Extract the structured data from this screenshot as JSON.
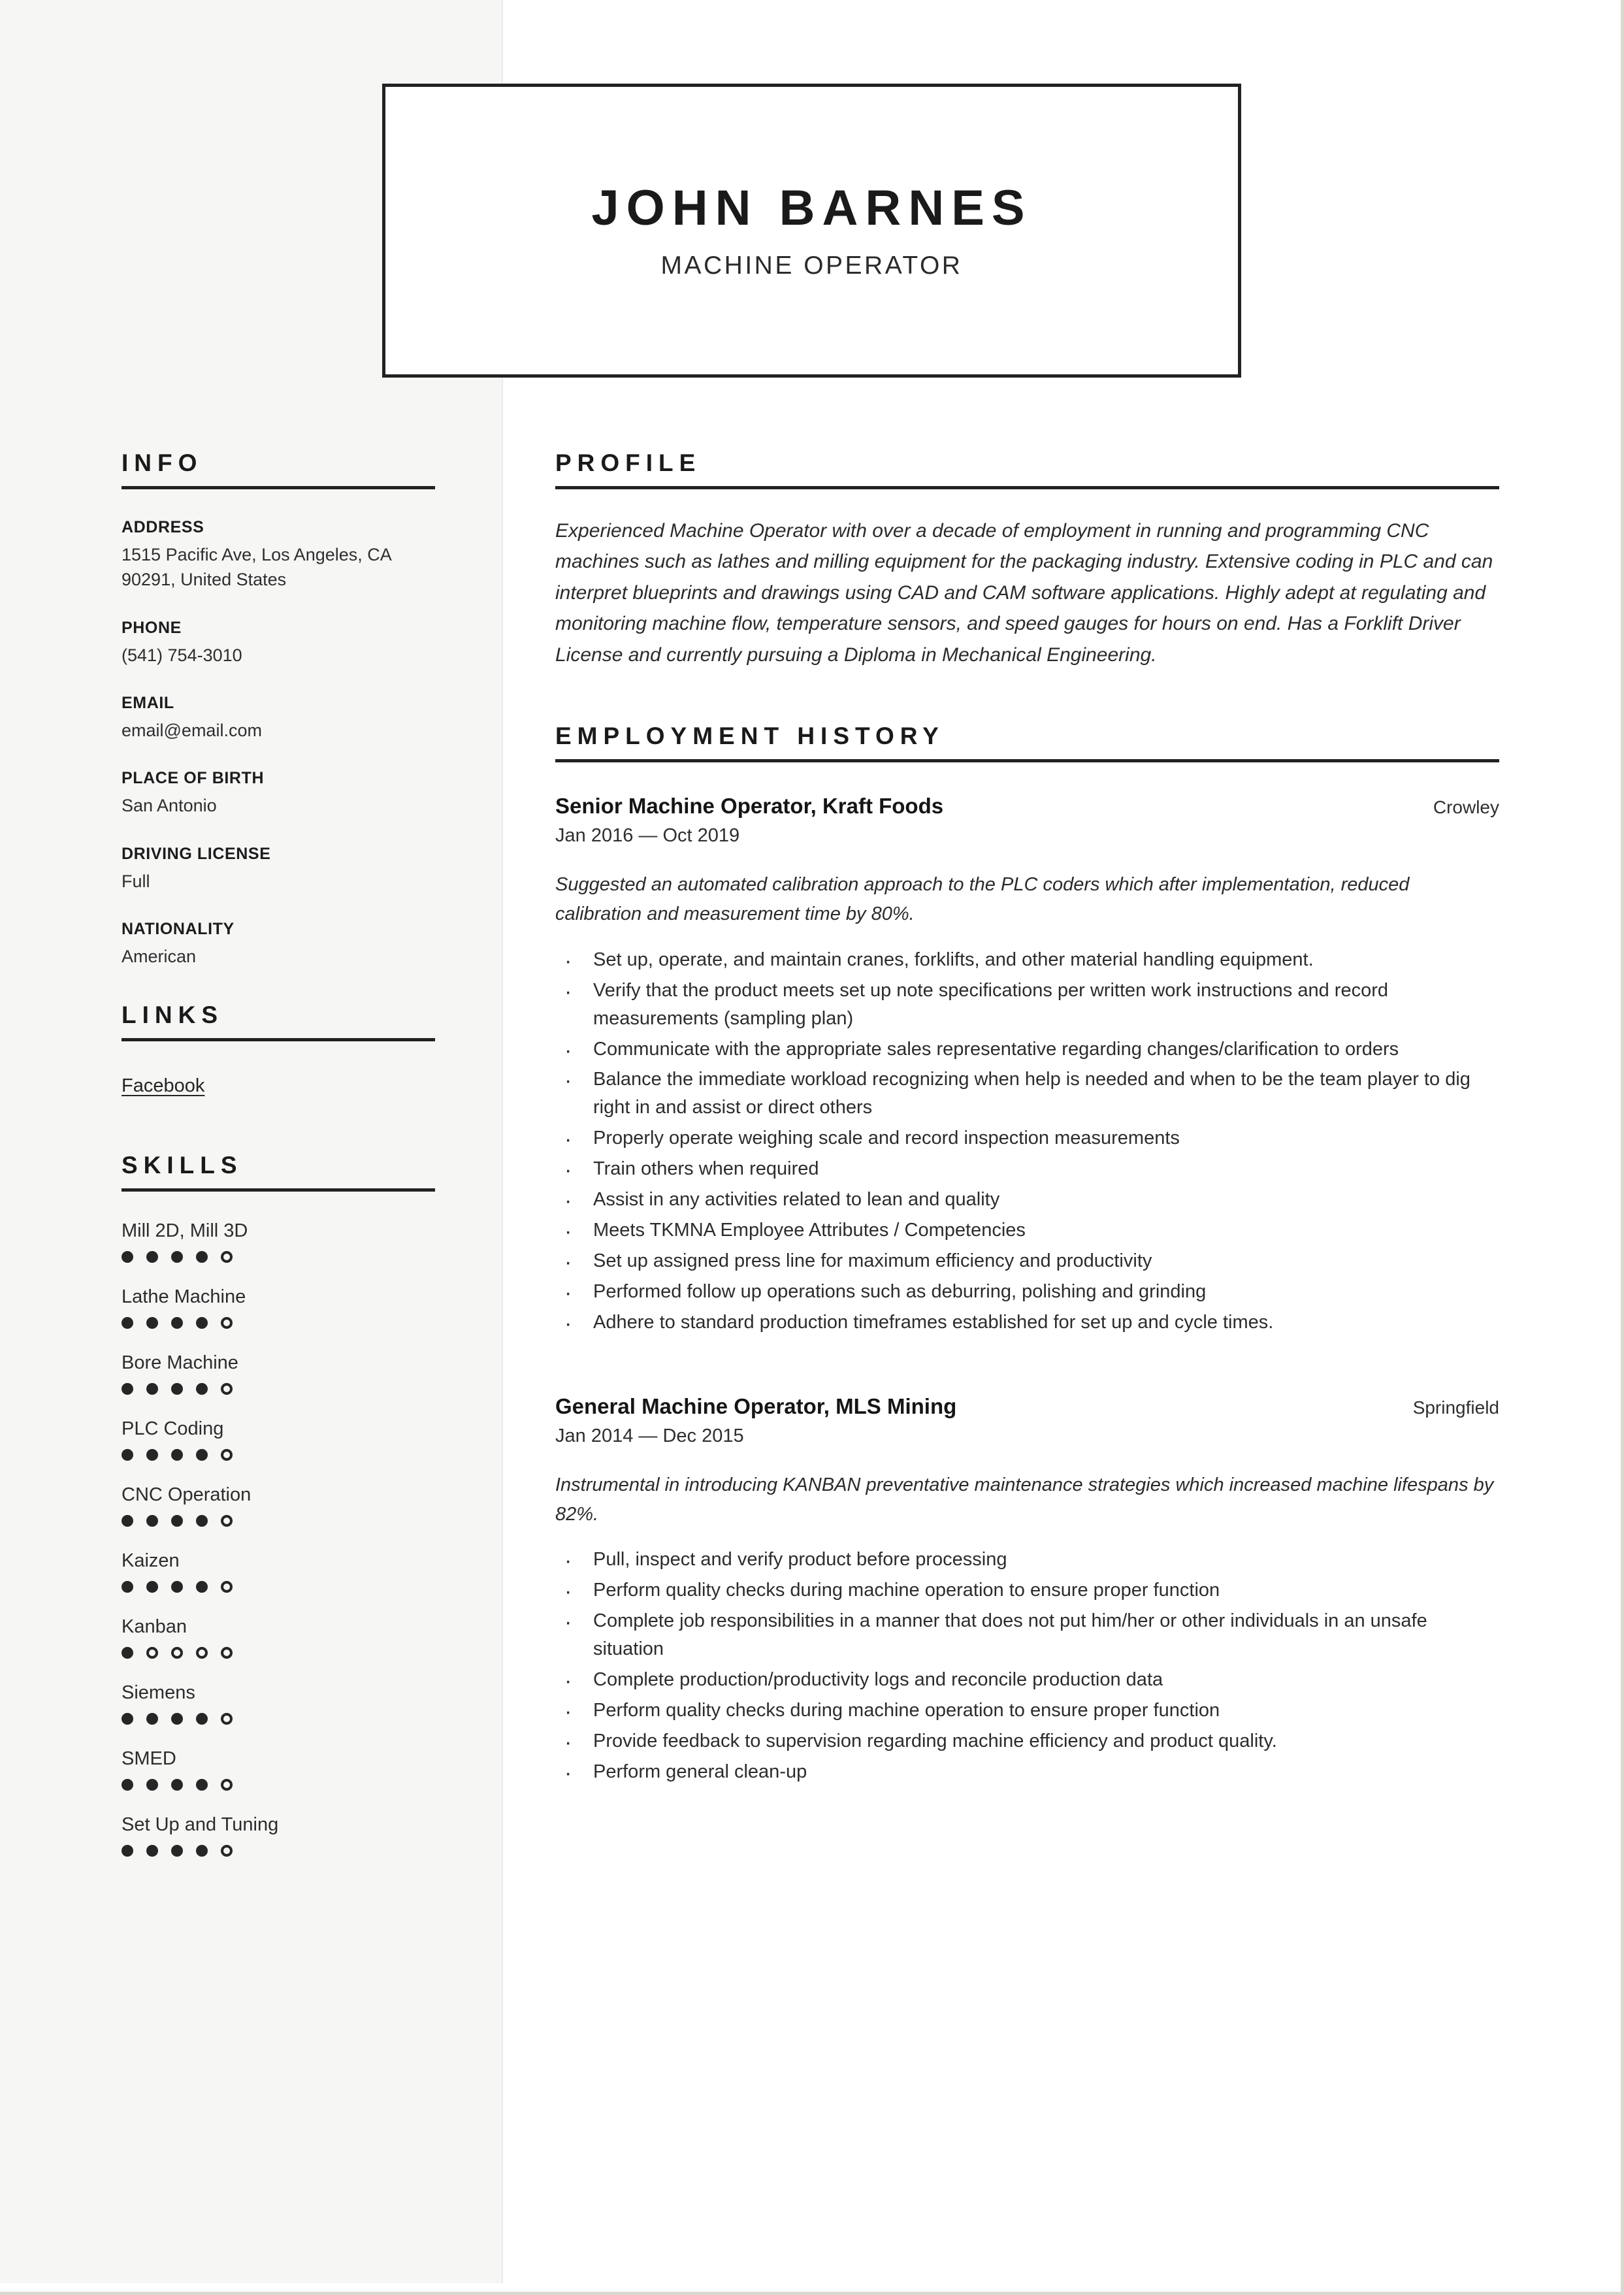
{
  "header": {
    "name": "JOHN BARNES",
    "title": "MACHINE OPERATOR"
  },
  "sidebar": {
    "info": {
      "heading": "INFO",
      "fields": [
        {
          "label": "ADDRESS",
          "value": "1515 Pacific Ave, Los Angeles, CA 90291, United States"
        },
        {
          "label": "PHONE",
          "value": "(541) 754-3010"
        },
        {
          "label": "EMAIL",
          "value": "email@email.com"
        },
        {
          "label": "PLACE OF BIRTH",
          "value": "San Antonio"
        },
        {
          "label": "DRIVING LICENSE",
          "value": "Full"
        },
        {
          "label": "NATIONALITY",
          "value": "American"
        }
      ]
    },
    "links": {
      "heading": "LINKS",
      "items": [
        {
          "label": "Facebook"
        }
      ]
    },
    "skills": {
      "heading": "SKILLS",
      "max_rating": 5,
      "items": [
        {
          "name": "Mill 2D, Mill 3D",
          "rating": 4
        },
        {
          "name": "Lathe Machine",
          "rating": 4
        },
        {
          "name": "Bore Machine",
          "rating": 4
        },
        {
          "name": "PLC Coding",
          "rating": 4
        },
        {
          "name": "CNC Operation",
          "rating": 4
        },
        {
          "name": "Kaizen",
          "rating": 4
        },
        {
          "name": "Kanban",
          "rating": 1
        },
        {
          "name": "Siemens",
          "rating": 4
        },
        {
          "name": "SMED",
          "rating": 4
        },
        {
          "name": "Set Up and Tuning",
          "rating": 4
        }
      ]
    }
  },
  "main": {
    "profile": {
      "heading": "PROFILE",
      "text": "Experienced Machine Operator with over a decade of employment in running and programming CNC machines such as lathes and milling equipment for the packaging industry. Extensive coding in PLC and can interpret blueprints and drawings using CAD and CAM software applications. Highly adept at regulating and monitoring machine flow, temperature sensors, and speed gauges for hours on end. Has a Forklift Driver License and currently pursuing a Diploma in Mechanical Engineering."
    },
    "employment": {
      "heading": "EMPLOYMENT HISTORY",
      "jobs": [
        {
          "title": "Senior Machine Operator, Kraft Foods",
          "city": "Crowley",
          "dates": "Jan 2016 — Oct 2019",
          "summary": "Suggested an automated calibration approach to the PLC coders which after implementation, reduced calibration and measurement time by 80%.",
          "bullets": [
            "Set up, operate, and maintain cranes, forklifts, and other material handling equipment.",
            "Verify that the product meets set up note specifications per written work instructions and record measurements (sampling plan)",
            "Communicate with the appropriate sales representative regarding changes/clarification to orders",
            "Balance the immediate workload recognizing when help is needed and when to be the team player to dig right in and assist or direct others",
            "Properly operate weighing scale and record inspection measurements",
            "Train others when required",
            "Assist in any activities related to lean and quality",
            "Meets TKMNA Employee Attributes / Competencies",
            "Set up assigned press line for maximum efficiency and productivity",
            "Performed follow up operations such as deburring, polishing and grinding",
            "Adhere to standard production timeframes established for set up and cycle times."
          ]
        },
        {
          "title": "General Machine Operator, MLS Mining",
          "city": "Springfield",
          "dates": "Jan 2014 — Dec 2015",
          "summary": "Instrumental in introducing KANBAN preventative maintenance strategies which increased machine lifespans by 82%.",
          "bullets": [
            "Pull, inspect and verify product before processing",
            "Perform quality checks during machine operation to ensure proper function",
            "Complete job responsibilities in a manner that does not put him/her or other individuals in an unsafe situation",
            "Complete production/productivity logs and reconcile production data",
            "Perform quality checks during machine operation to ensure proper function",
            "Provide feedback to supervision regarding machine efficiency and product quality.",
            "Perform general clean-up"
          ]
        }
      ]
    }
  },
  "colors": {
    "ink": "#1a1a1a",
    "body": "#2c2c2c",
    "sidebar_bg": "#f6f6f5",
    "rule": "#222222"
  }
}
